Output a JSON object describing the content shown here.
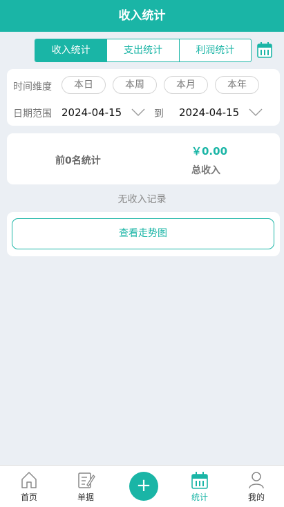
{
  "header": {
    "title": "收入统计"
  },
  "segment": {
    "tabs": [
      "收入统计",
      "支出统计",
      "利润统计"
    ],
    "active": 0
  },
  "filter": {
    "dimension_label": "时间维度",
    "dimension_options": [
      "本日",
      "本周",
      "本月",
      "本年"
    ],
    "range_label": "日期范围",
    "start_date": "2024-04-15",
    "to_label": "到",
    "end_date": "2024-04-15"
  },
  "summary": {
    "top_label": "前0名统计",
    "total_amount": "￥0.00",
    "total_label": "总收入"
  },
  "empty_note": "无收入记录",
  "trend_button": "查看走势图",
  "tabbar": {
    "items": [
      {
        "label": "首页",
        "icon": "home-icon"
      },
      {
        "label": "单据",
        "icon": "document-edit-icon"
      },
      {
        "label": "统计",
        "icon": "calendar-icon"
      },
      {
        "label": "我的",
        "icon": "user-icon"
      }
    ],
    "add_symbol": "+",
    "active": "统计"
  },
  "colors": {
    "accent": "#1ab5a6",
    "background": "#ebeff4"
  }
}
